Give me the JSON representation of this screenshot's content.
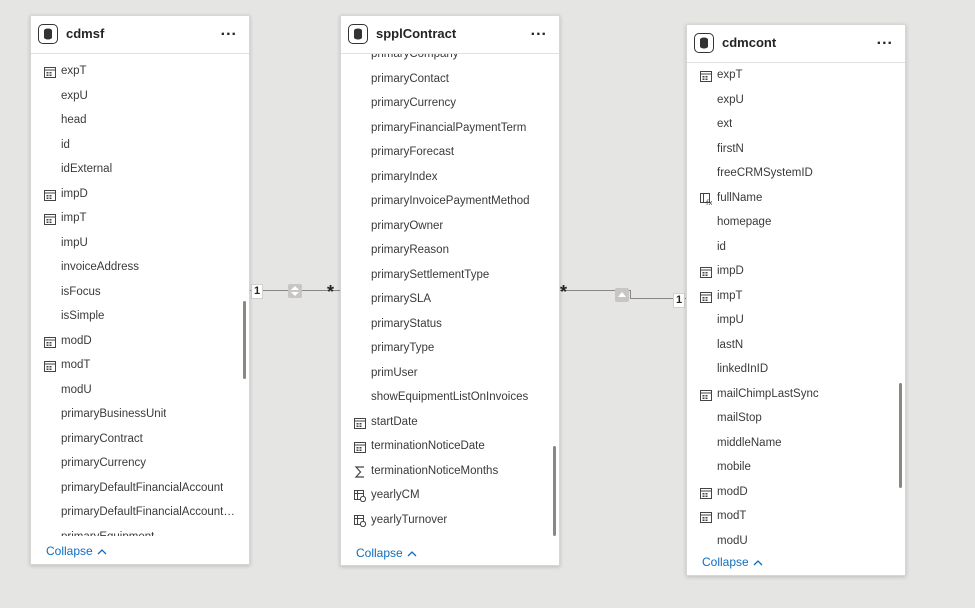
{
  "tables": {
    "cdmsf": {
      "title": "cdmsf",
      "more_label": "...",
      "collapse_label": "Collapse",
      "fields": [
        {
          "name": "expT",
          "icon": "calendar-icon"
        },
        {
          "name": "expU",
          "icon": ""
        },
        {
          "name": "head",
          "icon": ""
        },
        {
          "name": "id",
          "icon": ""
        },
        {
          "name": "idExternal",
          "icon": ""
        },
        {
          "name": "impD",
          "icon": "calendar-icon"
        },
        {
          "name": "impT",
          "icon": "calendar-icon"
        },
        {
          "name": "impU",
          "icon": ""
        },
        {
          "name": "invoiceAddress",
          "icon": ""
        },
        {
          "name": "isFocus",
          "icon": ""
        },
        {
          "name": "isSimple",
          "icon": ""
        },
        {
          "name": "modD",
          "icon": "calendar-icon"
        },
        {
          "name": "modT",
          "icon": "calendar-icon"
        },
        {
          "name": "modU",
          "icon": ""
        },
        {
          "name": "primaryBusinessUnit",
          "icon": ""
        },
        {
          "name": "primaryContract",
          "icon": ""
        },
        {
          "name": "primaryCurrency",
          "icon": ""
        },
        {
          "name": "primaryDefaultFinancialAccount",
          "icon": ""
        },
        {
          "name": "primaryDefaultFinancialAccountS...",
          "icon": ""
        },
        {
          "name": "primaryEquipment",
          "icon": ""
        }
      ]
    },
    "spplContract": {
      "title": "spplContract",
      "more_label": "...",
      "collapse_label": "Collapse",
      "fields": [
        {
          "name": "primaryCompany",
          "icon": ""
        },
        {
          "name": "primaryContact",
          "icon": ""
        },
        {
          "name": "primaryCurrency",
          "icon": ""
        },
        {
          "name": "primaryFinancialPaymentTerm",
          "icon": ""
        },
        {
          "name": "primaryForecast",
          "icon": ""
        },
        {
          "name": "primaryIndex",
          "icon": ""
        },
        {
          "name": "primaryInvoicePaymentMethod",
          "icon": ""
        },
        {
          "name": "primaryOwner",
          "icon": ""
        },
        {
          "name": "primaryReason",
          "icon": ""
        },
        {
          "name": "primarySettlementType",
          "icon": ""
        },
        {
          "name": "primarySLA",
          "icon": ""
        },
        {
          "name": "primaryStatus",
          "icon": ""
        },
        {
          "name": "primaryType",
          "icon": ""
        },
        {
          "name": "primUser",
          "icon": ""
        },
        {
          "name": "showEquipmentListOnInvoices",
          "icon": ""
        },
        {
          "name": "startDate",
          "icon": "calendar-icon"
        },
        {
          "name": "terminationNoticeDate",
          "icon": "calendar-icon"
        },
        {
          "name": "terminationNoticeMonths",
          "icon": "sigma-icon"
        },
        {
          "name": "yearlyCM",
          "icon": "measure-icon"
        },
        {
          "name": "yearlyTurnover",
          "icon": "measure-icon"
        }
      ]
    },
    "cdmcont": {
      "title": "cdmcont",
      "more_label": "...",
      "collapse_label": "Collapse",
      "fields": [
        {
          "name": "expT",
          "icon": "calendar-icon"
        },
        {
          "name": "expU",
          "icon": ""
        },
        {
          "name": "ext",
          "icon": ""
        },
        {
          "name": "firstN",
          "icon": ""
        },
        {
          "name": "freeCRMSystemID",
          "icon": ""
        },
        {
          "name": "fullName",
          "icon": "calculated-column-icon"
        },
        {
          "name": "homepage",
          "icon": ""
        },
        {
          "name": "id",
          "icon": ""
        },
        {
          "name": "impD",
          "icon": "calendar-icon"
        },
        {
          "name": "impT",
          "icon": "calendar-icon"
        },
        {
          "name": "impU",
          "icon": ""
        },
        {
          "name": "lastN",
          "icon": ""
        },
        {
          "name": "linkedInID",
          "icon": ""
        },
        {
          "name": "mailChimpLastSync",
          "icon": "calendar-icon"
        },
        {
          "name": "mailStop",
          "icon": ""
        },
        {
          "name": "middleName",
          "icon": ""
        },
        {
          "name": "mobile",
          "icon": ""
        },
        {
          "name": "modD",
          "icon": "calendar-icon"
        },
        {
          "name": "modT",
          "icon": "calendar-icon"
        },
        {
          "name": "modU",
          "icon": ""
        }
      ]
    }
  },
  "relationships": [
    {
      "from": "cdmsf",
      "to": "spplContract",
      "from_cardinality": "1",
      "to_cardinality": "*",
      "direction": "both"
    },
    {
      "from": "spplContract",
      "to": "cdmcont",
      "from_cardinality": "*",
      "to_cardinality": "1",
      "direction": "single"
    }
  ],
  "colors": {
    "background": "#e5e5e3",
    "card": "#ffffff",
    "link": "#106ebe",
    "line": "#8a8886"
  }
}
